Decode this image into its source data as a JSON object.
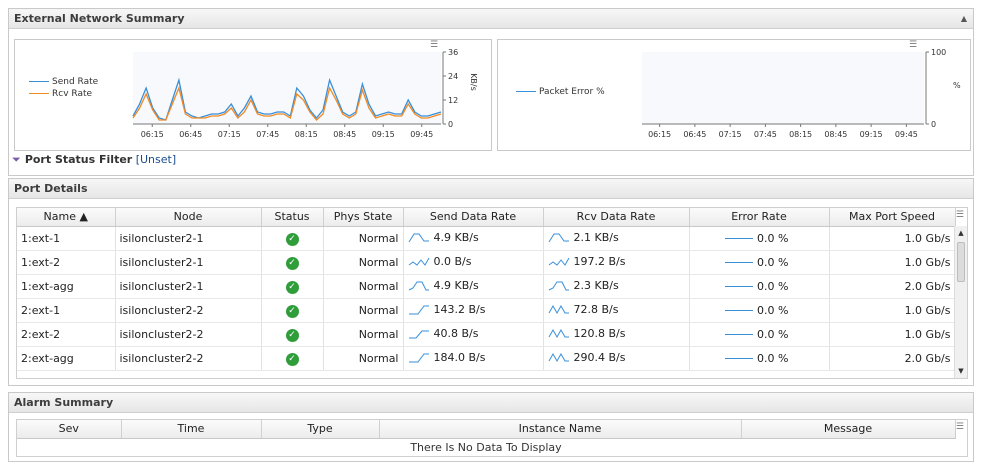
{
  "external": {
    "title": "External Network Summary",
    "collapse_icon": "▲",
    "chart_menu_icon": "☰",
    "chart_data": [
      {
        "type": "line",
        "x": [
          "06:00",
          "06:05",
          "06:10",
          "06:15",
          "06:20",
          "06:25",
          "06:30",
          "06:35",
          "06:40",
          "06:45",
          "06:50",
          "06:55",
          "07:00",
          "07:05",
          "07:10",
          "07:15",
          "07:20",
          "07:25",
          "07:30",
          "07:35",
          "07:40",
          "07:45",
          "07:50",
          "07:55",
          "08:00",
          "08:05",
          "08:10",
          "08:15",
          "08:20",
          "08:25",
          "08:30",
          "08:35",
          "08:40",
          "08:45",
          "08:50",
          "08:55",
          "09:00",
          "09:05",
          "09:10",
          "09:15",
          "09:20",
          "09:25",
          "09:30",
          "09:35",
          "09:40",
          "09:45",
          "09:50",
          "09:55"
        ],
        "series": [
          {
            "name": "Send Rate",
            "color": "#3a8fd9",
            "axis": "left",
            "values": [
              4,
              10,
              18,
              8,
              3,
              2,
              12,
              22,
              6,
              4,
              3,
              4,
              5,
              5,
              6,
              10,
              4,
              8,
              14,
              6,
              5,
              5,
              6,
              6,
              4,
              18,
              14,
              7,
              3,
              7,
              22,
              14,
              6,
              4,
              6,
              20,
              10,
              4,
              5,
              6,
              5,
              5,
              12,
              6,
              4,
              4,
              5,
              6
            ]
          },
          {
            "name": "Rcv Rate",
            "color": "#f08a24",
            "axis": "left",
            "values": [
              3,
              8,
              15,
              7,
              2,
              2,
              10,
              18,
              5,
              3,
              3,
              3,
              4,
              4,
              5,
              8,
              3,
              6,
              12,
              5,
              4,
              4,
              5,
              5,
              3,
              15,
              12,
              6,
              2,
              5,
              18,
              12,
              5,
              3,
              5,
              17,
              8,
              3,
              4,
              5,
              4,
              4,
              10,
              5,
              3,
              3,
              4,
              5
            ]
          }
        ],
        "xticks": [
          "06:15",
          "06:45",
          "07:15",
          "07:45",
          "08:15",
          "08:45",
          "09:15",
          "09:45"
        ],
        "yticks": [
          "0",
          "12",
          "24",
          "36"
        ],
        "ylim": [
          0,
          36
        ],
        "ylabel": "KB/s",
        "legend": "left"
      },
      {
        "type": "line",
        "xticks": [
          "06:15",
          "06:45",
          "07:15",
          "07:45",
          "08:15",
          "08:45",
          "09:15",
          "09:45"
        ],
        "series": [
          {
            "name": "Packet Error %",
            "color": "#3a8fd9",
            "axis": "right",
            "values": []
          }
        ],
        "yticks": [
          "0",
          "100"
        ],
        "ylim": [
          0,
          100
        ],
        "ylabel": "%",
        "legend": "left"
      }
    ]
  },
  "filter": {
    "icon": "funnel-icon",
    "title": "Port Status Filter",
    "value": "[Unset]"
  },
  "port_details": {
    "title": "Port Details",
    "columns": [
      "Name ▲",
      "Node",
      "Status",
      "Phys State",
      "Send Data Rate",
      "Rcv Data Rate",
      "Error Rate",
      "Max Port Speed"
    ],
    "column_menu_icon": "☰",
    "rows": [
      {
        "name": "1:ext-1",
        "node": "isiloncluster2-1",
        "status": "ok",
        "phys": "Normal",
        "send": "4.9 KB/s",
        "rcv": "2.1 KB/s",
        "error": "0.0 %",
        "speed": "1.0 Gb/s",
        "send_spark": "wave1",
        "rcv_spark": "wave1"
      },
      {
        "name": "1:ext-2",
        "node": "isiloncluster2-1",
        "status": "ok",
        "phys": "Normal",
        "send": "0.0 B/s",
        "rcv": "197.2 B/s",
        "error": "0.0 %",
        "speed": "1.0 Gb/s",
        "send_spark": "zig",
        "rcv_spark": "zig"
      },
      {
        "name": "1:ext-agg",
        "node": "isiloncluster2-1",
        "status": "ok",
        "phys": "Normal",
        "send": "4.9 KB/s",
        "rcv": "2.3 KB/s",
        "error": "0.0 %",
        "speed": "2.0 Gb/s",
        "send_spark": "hump",
        "rcv_spark": "hump"
      },
      {
        "name": "2:ext-1",
        "node": "isiloncluster2-2",
        "status": "ok",
        "phys": "Normal",
        "send": "143.2 B/s",
        "rcv": "72.8 B/s",
        "error": "0.0 %",
        "speed": "1.0 Gb/s",
        "send_spark": "rise",
        "rcv_spark": "double"
      },
      {
        "name": "2:ext-2",
        "node": "isiloncluster2-2",
        "status": "ok",
        "phys": "Normal",
        "send": "40.8 B/s",
        "rcv": "120.8 B/s",
        "error": "0.0 %",
        "speed": "1.0 Gb/s",
        "send_spark": "rise2",
        "rcv_spark": "double"
      },
      {
        "name": "2:ext-agg",
        "node": "isiloncluster2-2",
        "status": "ok",
        "phys": "Normal",
        "send": "184.0 B/s",
        "rcv": "290.4 B/s",
        "error": "0.0 %",
        "speed": "2.0 Gb/s",
        "send_spark": "rise",
        "rcv_spark": "double"
      }
    ]
  },
  "alarm_summary": {
    "title": "Alarm Summary",
    "columns": [
      "Sev",
      "Time",
      "Type",
      "Instance Name",
      "Message"
    ],
    "column_menu_icon": "☰",
    "empty_text": "There Is No Data To Display"
  },
  "colors": {
    "send": "#3a8fd9",
    "rcv": "#f08a24",
    "ok": "#2f9e3a",
    "link": "#1a4c8c"
  }
}
